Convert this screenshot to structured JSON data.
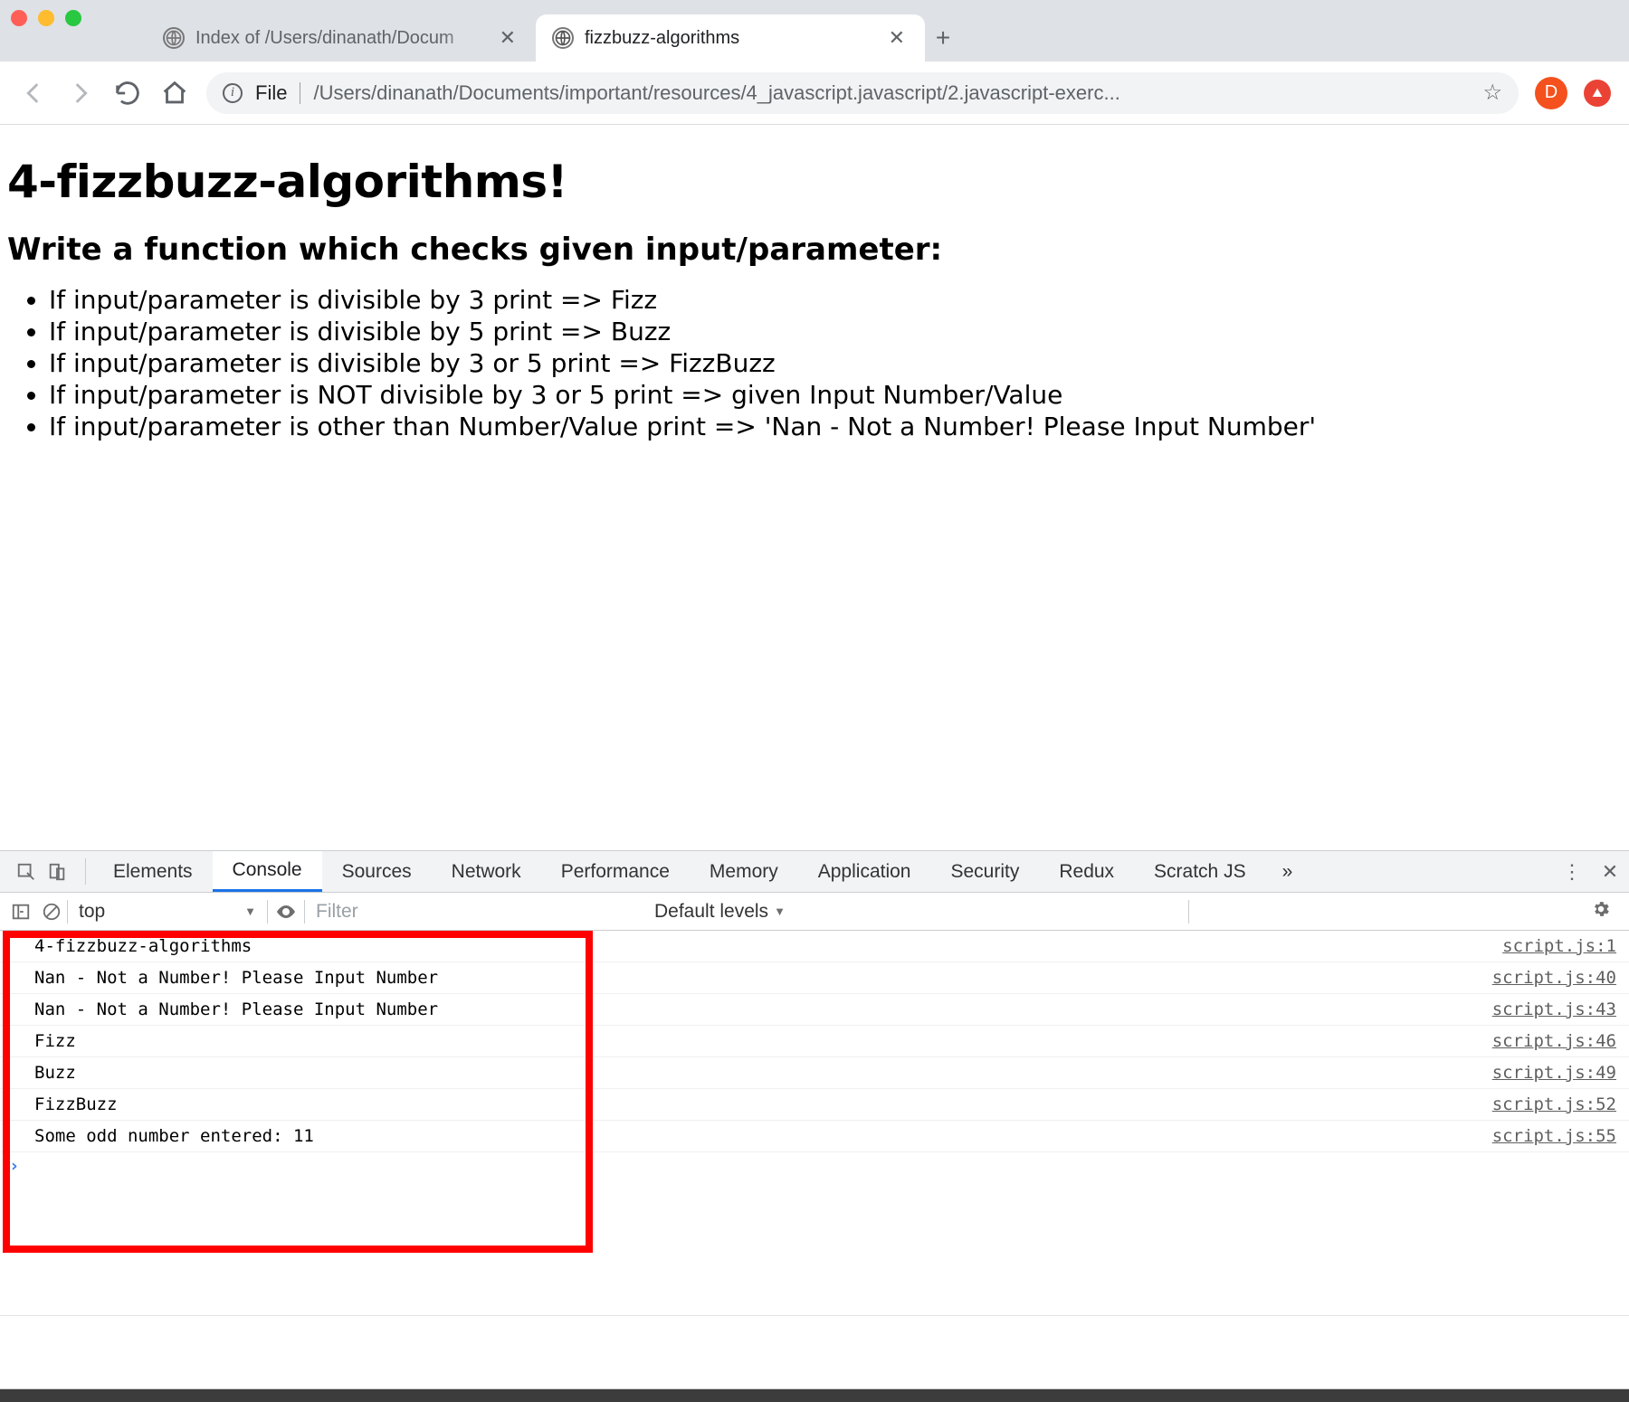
{
  "browser": {
    "tabs": [
      {
        "title": "Index of /Users/dinanath/Docum",
        "active": false
      },
      {
        "title": "fizzbuzz-algorithms",
        "active": true
      }
    ],
    "url_scheme_label": "File",
    "url_path": "/Users/dinanath/Documents/important/resources/4_javascript.javascript/2.javascript-exerc...",
    "avatar_letter": "D"
  },
  "page": {
    "h1": "4-fizzbuzz-algorithms!",
    "h3": "Write a function which checks given input/parameter:",
    "bullets": [
      "If input/parameter is divisible by 3 print => Fizz",
      "If input/parameter is divisible by 5 print => Buzz",
      "If input/parameter is divisible by 3 or 5 print => FizzBuzz",
      "If input/parameter is NOT divisible by 3 or 5 print => given Input Number/Value",
      "If input/parameter is other than Number/Value print => 'Nan - Not a Number! Please Input Number'"
    ]
  },
  "devtools": {
    "tabnames": [
      "Elements",
      "Console",
      "Sources",
      "Network",
      "Performance",
      "Memory",
      "Application",
      "Security",
      "Redux",
      "Scratch JS"
    ],
    "active_tab": "Console",
    "overflow_glyph": "»",
    "context_label": "top",
    "filter_placeholder": "Filter",
    "levels_label": "Default levels",
    "logs": [
      {
        "msg": "4-fizzbuzz-algorithms",
        "src": "script.js:1"
      },
      {
        "msg": "Nan - Not a Number! Please Input Number",
        "src": "script.js:40"
      },
      {
        "msg": "Nan - Not a Number! Please Input Number",
        "src": "script.js:43"
      },
      {
        "msg": "Fizz",
        "src": "script.js:46"
      },
      {
        "msg": "Buzz",
        "src": "script.js:49"
      },
      {
        "msg": "FizzBuzz",
        "src": "script.js:52"
      },
      {
        "msg": "Some odd number entered: 11",
        "src": "script.js:55"
      }
    ]
  }
}
